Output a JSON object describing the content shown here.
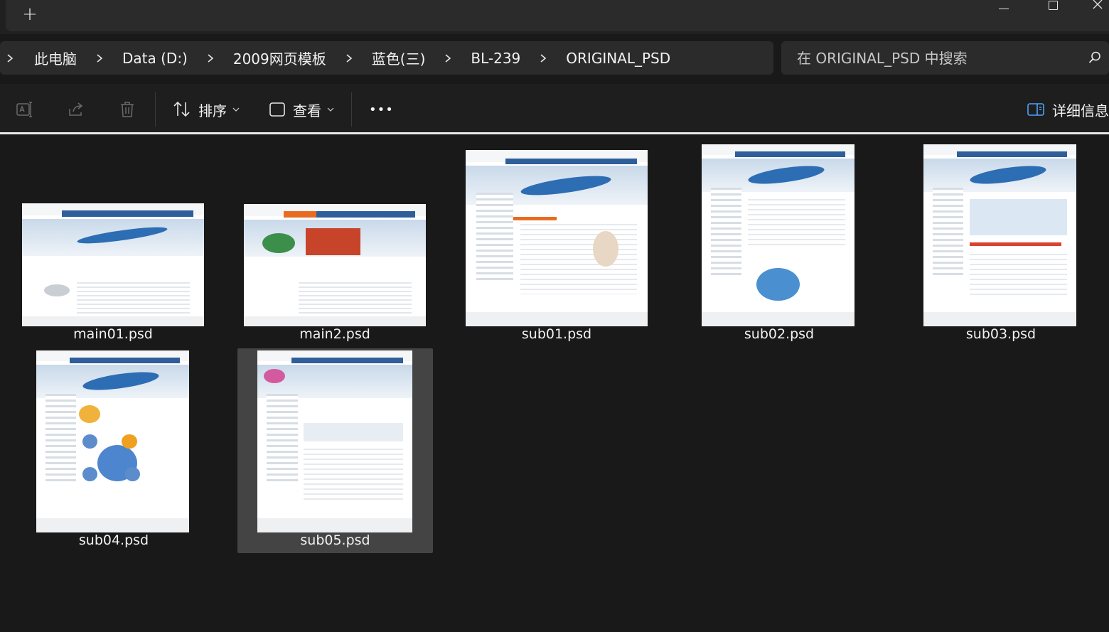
{
  "window": {
    "new_tab_label": "+"
  },
  "breadcrumb": {
    "items": [
      "此电脑",
      "Data (D:)",
      "2009网页模板",
      "蓝色(三)",
      "BL-239",
      "ORIGINAL_PSD"
    ]
  },
  "search": {
    "placeholder": "在 ORIGINAL_PSD 中搜索"
  },
  "toolbar": {
    "sort_label": "排序",
    "view_label": "查看",
    "more_label": "•••",
    "details_label": "详细信息"
  },
  "files": [
    {
      "name": "main01.psd",
      "selected": false
    },
    {
      "name": "main2.psd",
      "selected": false
    },
    {
      "name": "sub01.psd",
      "selected": false
    },
    {
      "name": "sub02.psd",
      "selected": false
    },
    {
      "name": "sub03.psd",
      "selected": false
    },
    {
      "name": "sub04.psd",
      "selected": false
    },
    {
      "name": "sub05.psd",
      "selected": true
    }
  ],
  "colors": {
    "background": "#191919",
    "panel": "#2b2b2b",
    "text": "#f2f2f2",
    "selection": "#444444",
    "thumb_blue": "#2f5f9a"
  }
}
